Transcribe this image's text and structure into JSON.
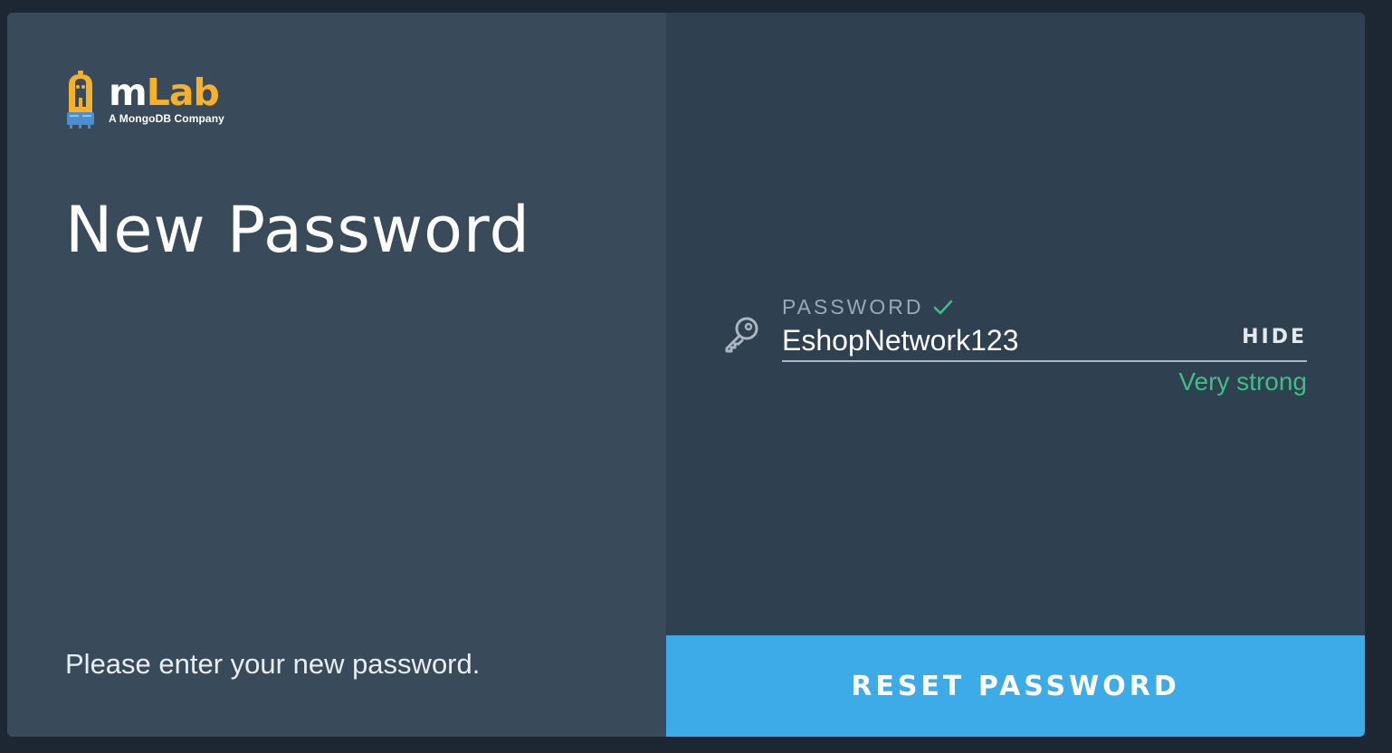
{
  "brand": {
    "logo_icon": "mlab-flask-icon",
    "wordmark_m": "m",
    "wordmark_lab": "Lab",
    "tagline": "A MongoDB Company",
    "accent_color": "#f5b12a"
  },
  "left": {
    "title": "New Password",
    "instructions": "Please enter your new password."
  },
  "form": {
    "password_label": "PASSWORD",
    "password_valid_icon": "check-icon",
    "field_icon": "key-icon",
    "password_value": "EshopNetwork123",
    "toggle_label": "HIDE",
    "strength_text": "Very strong",
    "strength_color": "#3fbf85"
  },
  "actions": {
    "submit_label": "RESET PASSWORD",
    "submit_color": "#3cabe7"
  }
}
